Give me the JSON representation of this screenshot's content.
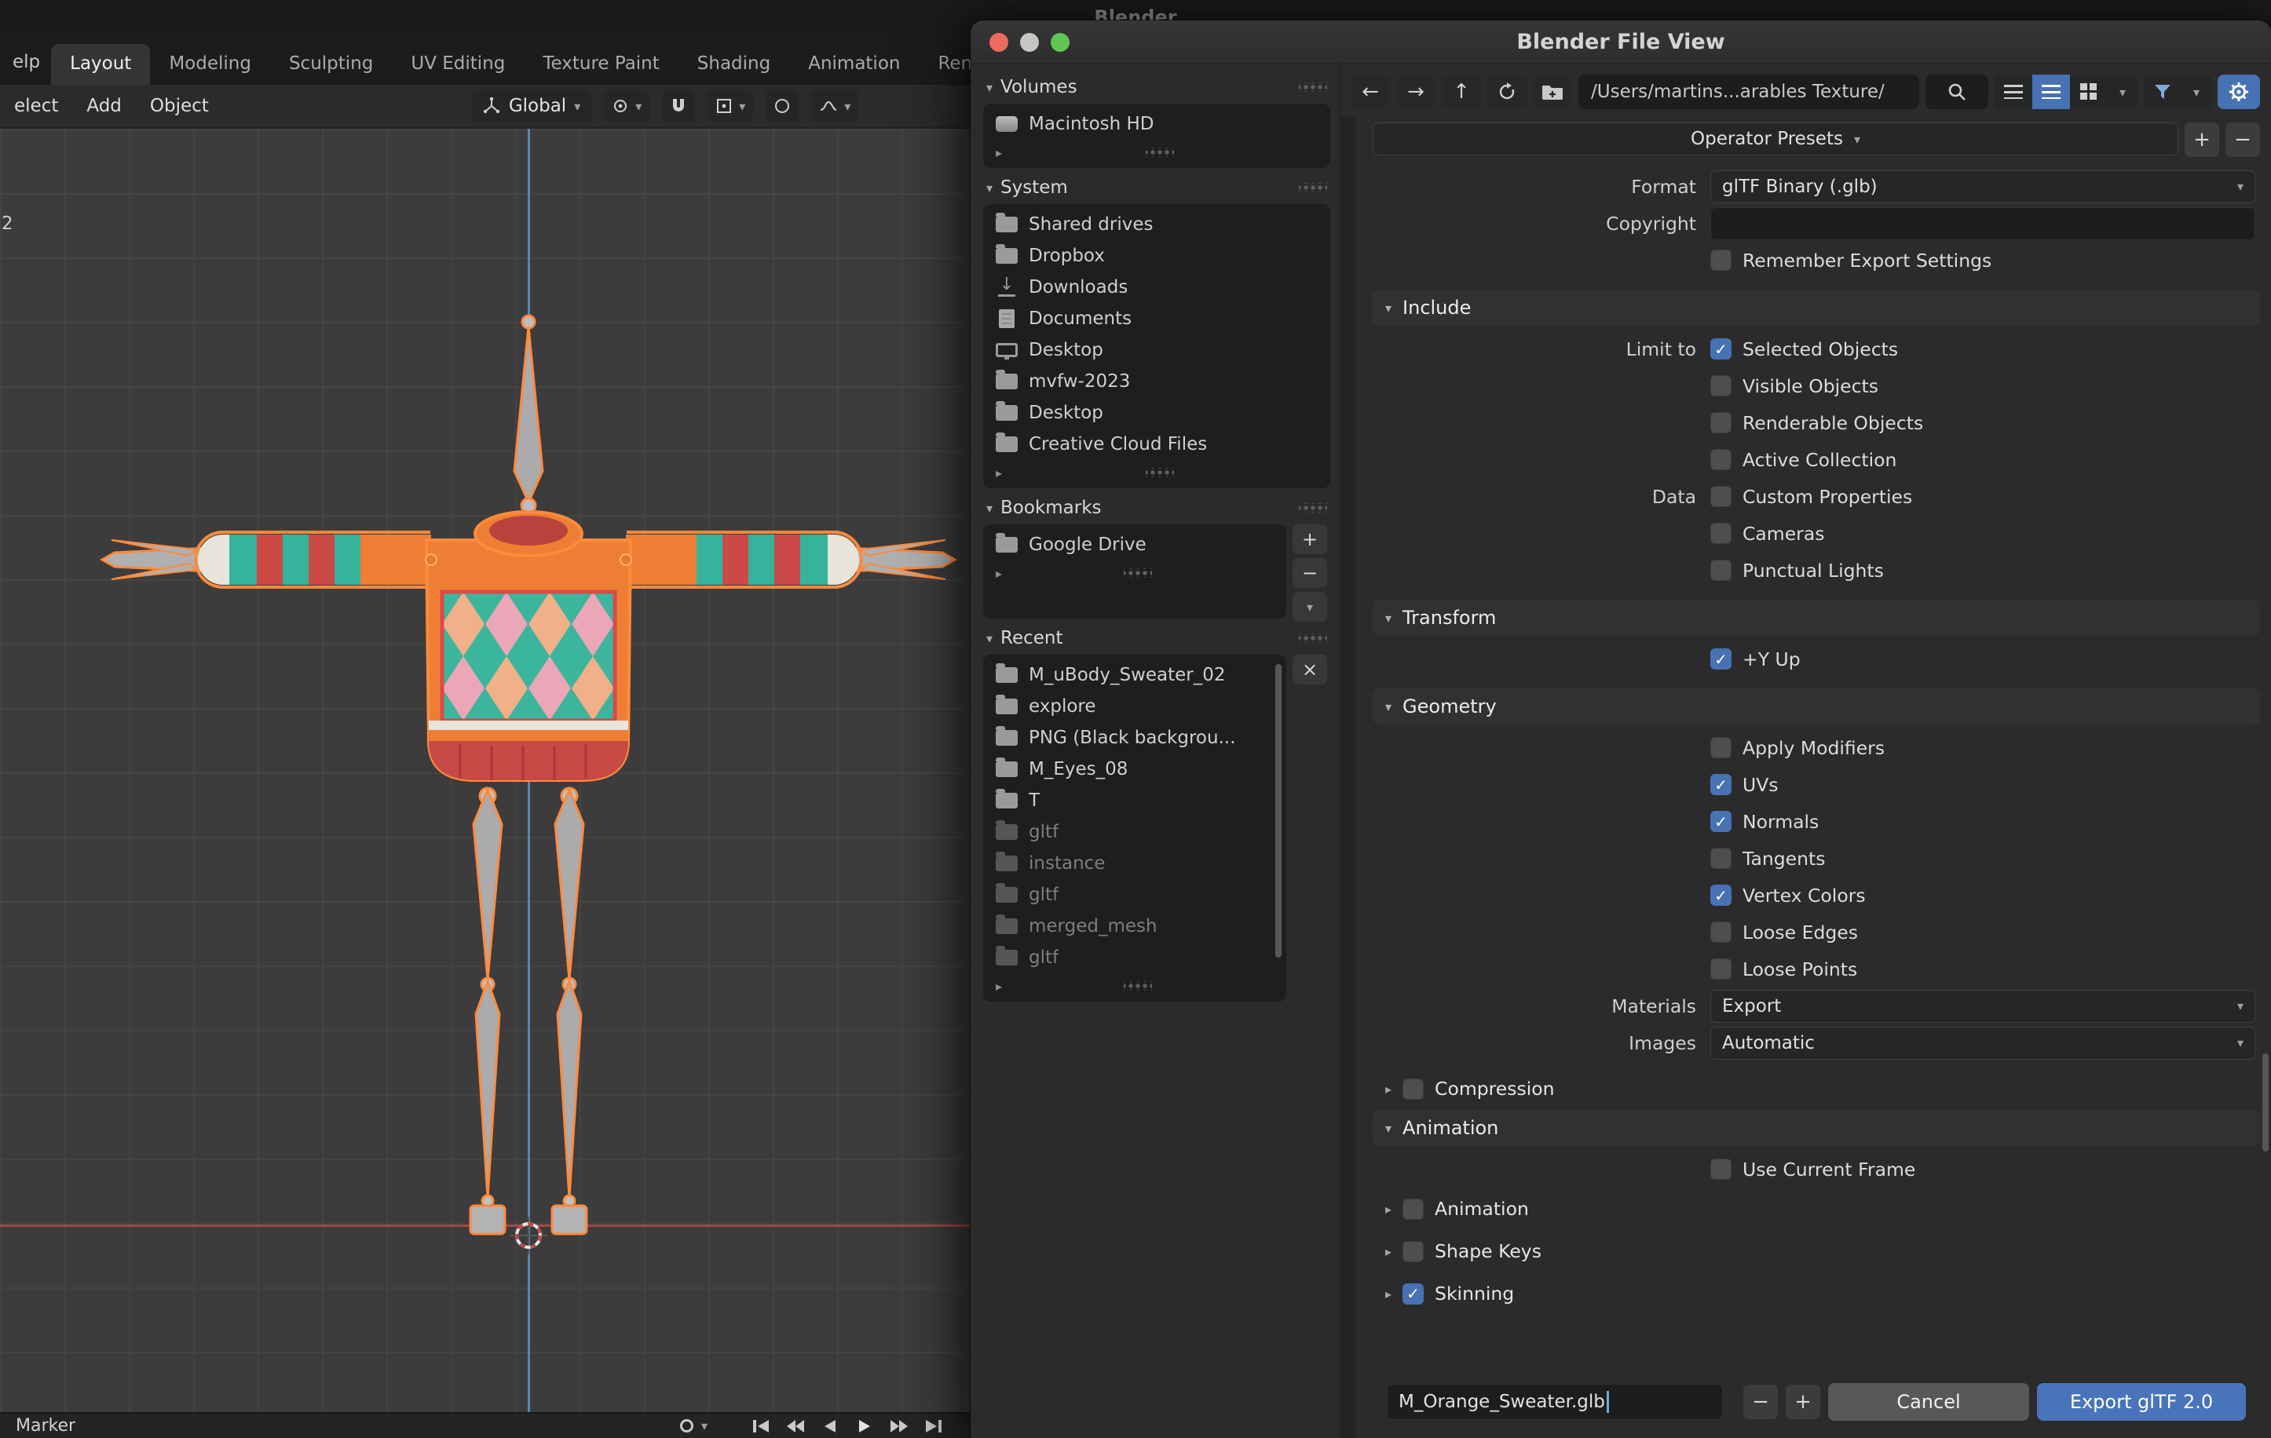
{
  "colors": {
    "accent_blue": "#4772b3",
    "selection_orange": "#ff8a3c",
    "viewport_bg": "#3c3c3c",
    "sweater_orange": "#ee7e33",
    "sweater_teal": "#3bb69c",
    "sweater_red": "#c84a45"
  },
  "background": {
    "window_title": "Blender",
    "menu_partial": "elp",
    "workspace_tabs": [
      {
        "label": "Layout",
        "active": true
      },
      {
        "label": "Modeling",
        "active": false
      },
      {
        "label": "Sculpting",
        "active": false
      },
      {
        "label": "UV Editing",
        "active": false
      },
      {
        "label": "Texture Paint",
        "active": false
      },
      {
        "label": "Shading",
        "active": false
      },
      {
        "label": "Animation",
        "active": false
      },
      {
        "label": "Rendering",
        "active": false
      }
    ],
    "tool_menus": [
      "elect",
      "Add",
      "Object"
    ],
    "orientation_value": "Global",
    "viewport_edge_label": "2",
    "timeline": {
      "marker_label": "Marker"
    }
  },
  "dialog": {
    "title": "Blender File View",
    "sidebar": {
      "volumes_title": "Volumes",
      "volumes": [
        {
          "label": "Macintosh HD"
        }
      ],
      "system_title": "System",
      "system": [
        {
          "label": "Shared drives"
        },
        {
          "label": "Dropbox"
        },
        {
          "label": "Downloads"
        },
        {
          "label": "Documents"
        },
        {
          "label": "Desktop"
        },
        {
          "label": "mvfw-2023"
        },
        {
          "label": "Desktop"
        },
        {
          "label": "Creative Cloud Files"
        }
      ],
      "bookmarks_title": "Bookmarks",
      "bookmarks": [
        {
          "label": "Google Drive"
        }
      ],
      "recent_title": "Recent",
      "recent": [
        {
          "label": "M_uBody_Sweater_02",
          "dim": false
        },
        {
          "label": "explore",
          "dim": false
        },
        {
          "label": "PNG (Black backgrou...",
          "dim": false
        },
        {
          "label": "M_Eyes_08",
          "dim": false
        },
        {
          "label": "T",
          "dim": false
        },
        {
          "label": "gltf",
          "dim": true
        },
        {
          "label": "instance",
          "dim": true
        },
        {
          "label": "gltf",
          "dim": true
        },
        {
          "label": "merged_mesh",
          "dim": true
        },
        {
          "label": "gltf",
          "dim": true
        }
      ]
    },
    "toolbar": {
      "path": "/Users/martins...arables Texture/"
    },
    "options": {
      "presets": "Operator Presets",
      "format_label": "Format",
      "format_value": "glTF Binary (.glb)",
      "copyright_label": "Copyright",
      "copyright_value": "",
      "remember": {
        "label": "Remember Export Settings",
        "checked": false
      },
      "include_title": "Include",
      "include_rows": [
        {
          "left": "Limit to",
          "label": "Selected Objects",
          "checked": true
        },
        {
          "left": "",
          "label": "Visible Objects",
          "checked": false
        },
        {
          "left": "",
          "label": "Renderable Objects",
          "checked": false
        },
        {
          "left": "",
          "label": "Active Collection",
          "checked": false
        },
        {
          "left": "Data",
          "label": "Custom Properties",
          "checked": false
        },
        {
          "left": "",
          "label": "Cameras",
          "checked": false
        },
        {
          "left": "",
          "label": "Punctual Lights",
          "checked": false
        }
      ],
      "transform_title": "Transform",
      "transform_rows": [
        {
          "left": "",
          "label": "+Y Up",
          "checked": true
        }
      ],
      "geometry_title": "Geometry",
      "geometry_rows": [
        {
          "left": "",
          "label": "Apply Modifiers",
          "checked": false
        },
        {
          "left": "",
          "label": "UVs",
          "checked": true
        },
        {
          "left": "",
          "label": "Normals",
          "checked": true
        },
        {
          "left": "",
          "label": "Tangents",
          "checked": false
        },
        {
          "left": "",
          "label": "Vertex Colors",
          "checked": true
        },
        {
          "left": "",
          "label": "Loose Edges",
          "checked": false
        },
        {
          "left": "",
          "label": "Loose Points",
          "checked": false
        }
      ],
      "materials_label": "Materials",
      "materials_value": "Export",
      "images_label": "Images",
      "images_value": "Automatic",
      "compression": {
        "label": "Compression",
        "checked": false
      },
      "animation_title": "Animation",
      "use_current_frame": {
        "label": "Use Current Frame",
        "checked": false
      },
      "animation_subs": [
        {
          "label": "Animation",
          "checked": false
        },
        {
          "label": "Shape Keys",
          "checked": false
        },
        {
          "label": "Skinning",
          "checked": true
        }
      ]
    },
    "footer": {
      "filename": "M_Orange_Sweater.glb",
      "cancel": "Cancel",
      "export": "Export glTF 2.0"
    }
  }
}
